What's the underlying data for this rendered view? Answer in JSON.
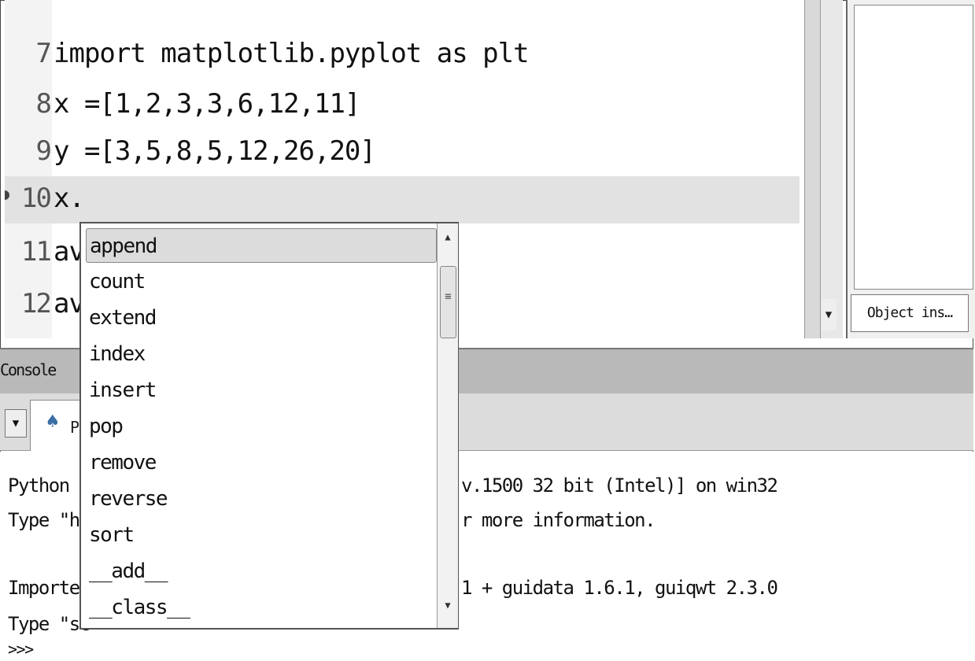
{
  "editor": {
    "lines": [
      {
        "num": "7",
        "code": "import matplotlib.pyplot as plt"
      },
      {
        "num": "8",
        "code": "x =[1,2,3,3,6,12,11]"
      },
      {
        "num": "9",
        "code": "y =[3,5,8,5,12,26,20]"
      },
      {
        "num": "10",
        "code": "x."
      },
      {
        "num": "11",
        "code": "av"
      },
      {
        "num": "12",
        "code": "av"
      }
    ]
  },
  "right_pane": {
    "tab_label": "Object ins…"
  },
  "console": {
    "title": "Console",
    "tab_label": "Py",
    "lines_left": [
      "Python 2.",
      "Type \"he",
      "",
      "Imported",
      "Type \"sc",
      ">>>"
    ],
    "lines_right": [
      "v.1500 32 bit (Intel)] on win32",
      "r more information.",
      "",
      "1 + guidata 1.6.1, guiqwt 2.3.0"
    ]
  },
  "autocomplete": {
    "items": [
      "append",
      "count",
      "extend",
      "index",
      "insert",
      "pop",
      "remove",
      "reverse",
      "sort",
      "__add__",
      "__class__"
    ],
    "selected_index": 0
  },
  "icons": {
    "scroll_up": "▲",
    "scroll_down": "▼",
    "grip": "≡",
    "python_icon": "♠"
  }
}
